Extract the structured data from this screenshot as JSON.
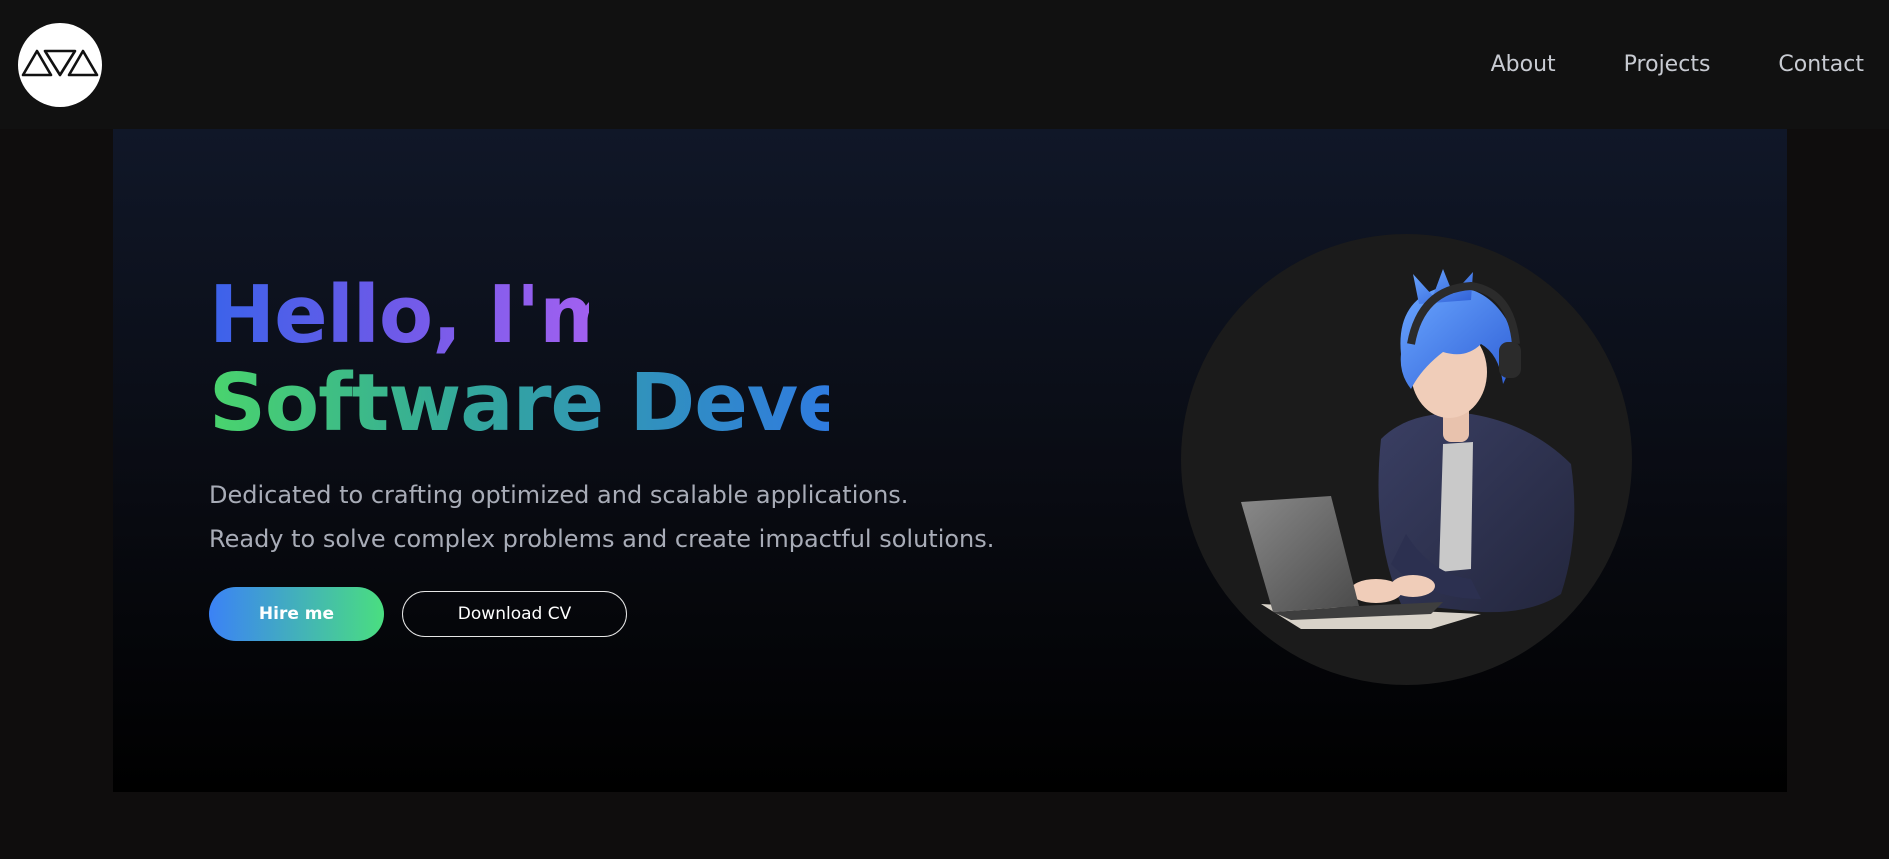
{
  "nav": {
    "links": [
      "About",
      "Projects",
      "Contact"
    ]
  },
  "hero": {
    "title_line1": "Hello, I'm",
    "title_line2": "Software Devel",
    "description": [
      "Dedicated to crafting optimized and scalable applications.",
      "Ready to solve complex problems and create impactful solutions."
    ],
    "hire_button": "Hire me",
    "cv_button": "Download CV"
  },
  "icons": {
    "logo": "logo-triangles-icon",
    "avatar": "developer-illustration"
  },
  "colors": {
    "page_bg": "#0f0d0d",
    "navbar_bg": "#111111",
    "nav_text": "#c8cbd2",
    "title_gradient_1": [
      "#3b63ea",
      "#a160f0"
    ],
    "title_gradient_2": [
      "#4ad46d",
      "#2f7be0"
    ],
    "desc_text": "#a8acb7",
    "button_gradient": [
      "#3b82f6",
      "#4ade80"
    ],
    "avatar_bg": "#1b1b1b"
  }
}
